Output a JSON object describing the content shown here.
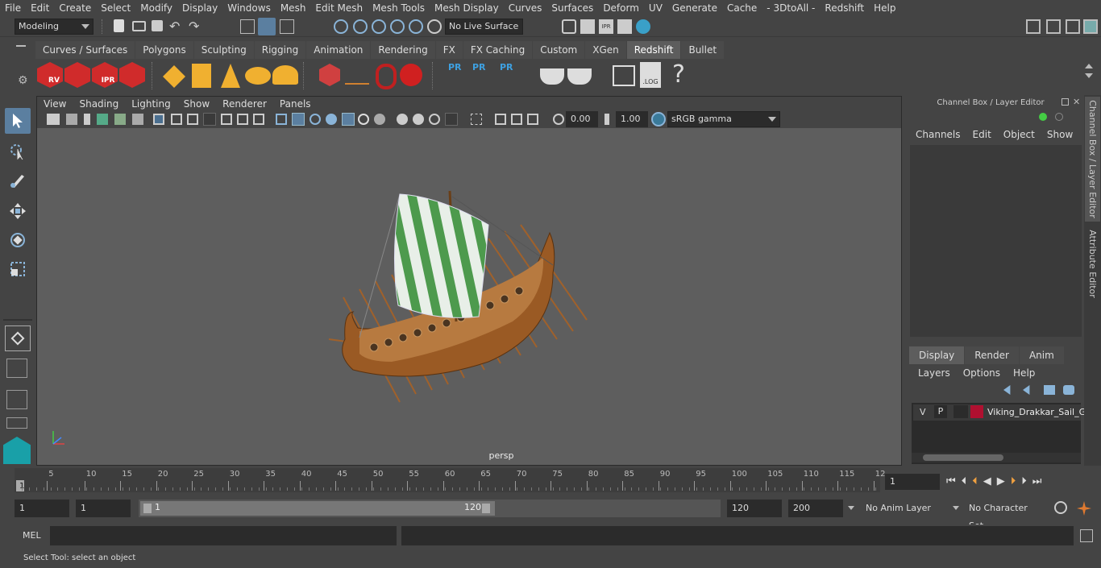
{
  "menubar": {
    "items": [
      "File",
      "Edit",
      "Create",
      "Select",
      "Modify",
      "Display",
      "Windows",
      "Mesh",
      "Edit Mesh",
      "Mesh Tools",
      "Mesh Display",
      "Curves",
      "Surfaces",
      "Deform",
      "UV",
      "Generate",
      "Cache",
      "- 3DtoAll -",
      "Redshift",
      "Help"
    ]
  },
  "status": {
    "mode": "Modeling",
    "live_surface": "No Live Surface"
  },
  "shelf": {
    "tabs": [
      "Curves / Surfaces",
      "Polygons",
      "Sculpting",
      "Rigging",
      "Animation",
      "Rendering",
      "FX",
      "FX Caching",
      "Custom",
      "XGen",
      "Redshift",
      "Bullet"
    ],
    "active": "Redshift",
    "labels": {
      "rv": "RV",
      "ipr": "IPR",
      "pr": "PR",
      "log": ".LOG",
      "help": "?"
    }
  },
  "panel": {
    "menus": [
      "View",
      "Shading",
      "Lighting",
      "Show",
      "Renderer",
      "Panels"
    ],
    "exposure": "0.00",
    "gamma": "1.00",
    "colorspace": "sRGB gamma",
    "camera": "persp"
  },
  "channelbox": {
    "title": "Channel Box / Layer Editor",
    "menus": [
      "Channels",
      "Edit",
      "Object",
      "Show"
    ],
    "layer_tabs": [
      "Display",
      "Render",
      "Anim"
    ],
    "layer_active": "Display",
    "layer_menus": [
      "Layers",
      "Options",
      "Help"
    ],
    "layer": {
      "v": "V",
      "p": "P",
      "name": "Viking_Drakkar_Sail_G",
      "color": "#b01030"
    }
  },
  "sidetabs": {
    "channel": "Channel Box / Layer Editor",
    "attr": "Attribute Editor"
  },
  "timeline": {
    "ticks": [
      "5",
      "10",
      "15",
      "20",
      "25",
      "30",
      "35",
      "40",
      "45",
      "50",
      "55",
      "60",
      "65",
      "70",
      "75",
      "80",
      "85",
      "90",
      "95",
      "100",
      "105",
      "110",
      "115",
      "12"
    ],
    "start_label": "1",
    "current": "1"
  },
  "range": {
    "start": "1",
    "anim_start": "1",
    "slider_start": "1",
    "slider_end": "120",
    "end": "120",
    "anim_end": "200",
    "anim_layer": "No Anim Layer",
    "char_set": "No Character Set"
  },
  "mel": {
    "label": "MEL"
  },
  "help": {
    "text": "Select Tool: select an object"
  }
}
